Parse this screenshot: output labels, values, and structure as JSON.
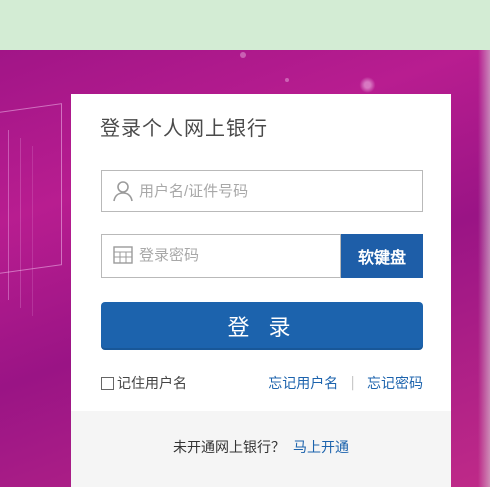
{
  "page": {
    "title": "登录个人网上银行"
  },
  "form": {
    "username": {
      "placeholder": "用户名/证件号码",
      "value": ""
    },
    "password": {
      "placeholder": "登录密码",
      "value": ""
    },
    "soft_keyboard_label": "软键盘",
    "login_button_label": "登 录",
    "remember_label": "记住用户名",
    "forgot_username_label": "忘记用户名",
    "separator": "|",
    "forgot_password_label": "忘记密码"
  },
  "footer": {
    "question": "未开通网上银行？",
    "link_label": "马上开通"
  },
  "colors": {
    "primary": "#1c63ad",
    "primary_dark": "#1e5ea8",
    "page_top": "#d3ecd4",
    "hero_magenta": "#a11587"
  }
}
